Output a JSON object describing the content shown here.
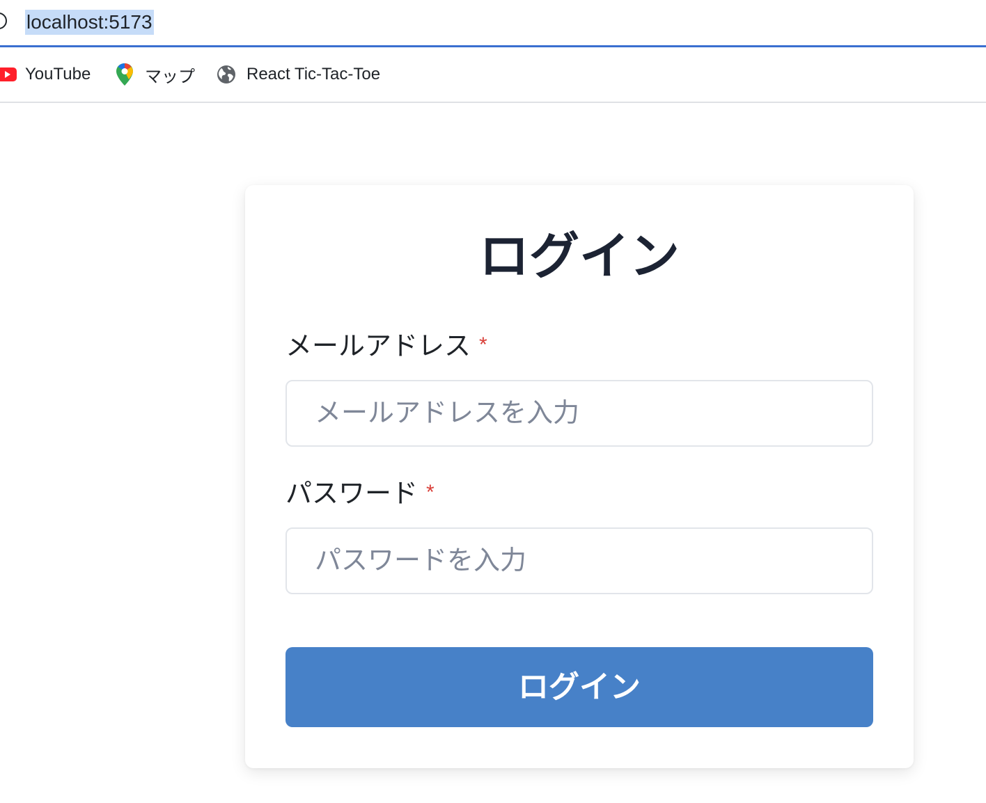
{
  "browser": {
    "url": "localhost:5173",
    "bookmarks": [
      {
        "label": "YouTube",
        "icon": "youtube-icon"
      },
      {
        "label": "マップ",
        "icon": "google-maps-icon"
      },
      {
        "label": "React Tic-Tac-Toe",
        "icon": "globe-icon"
      }
    ]
  },
  "login": {
    "title": "ログイン",
    "email": {
      "label": "メールアドレス",
      "required_mark": "*",
      "placeholder": "メールアドレスを入力",
      "value": ""
    },
    "password": {
      "label": "パスワード",
      "required_mark": "*",
      "placeholder": "パスワードを入力",
      "value": ""
    },
    "submit_label": "ログイン"
  },
  "colors": {
    "address_underline": "#3a6fd0",
    "url_highlight": "#c6dcf8",
    "button_primary": "#4781c8",
    "required_mark": "#d9403a",
    "title_text": "#1c2333",
    "placeholder_text": "#7f8798"
  }
}
